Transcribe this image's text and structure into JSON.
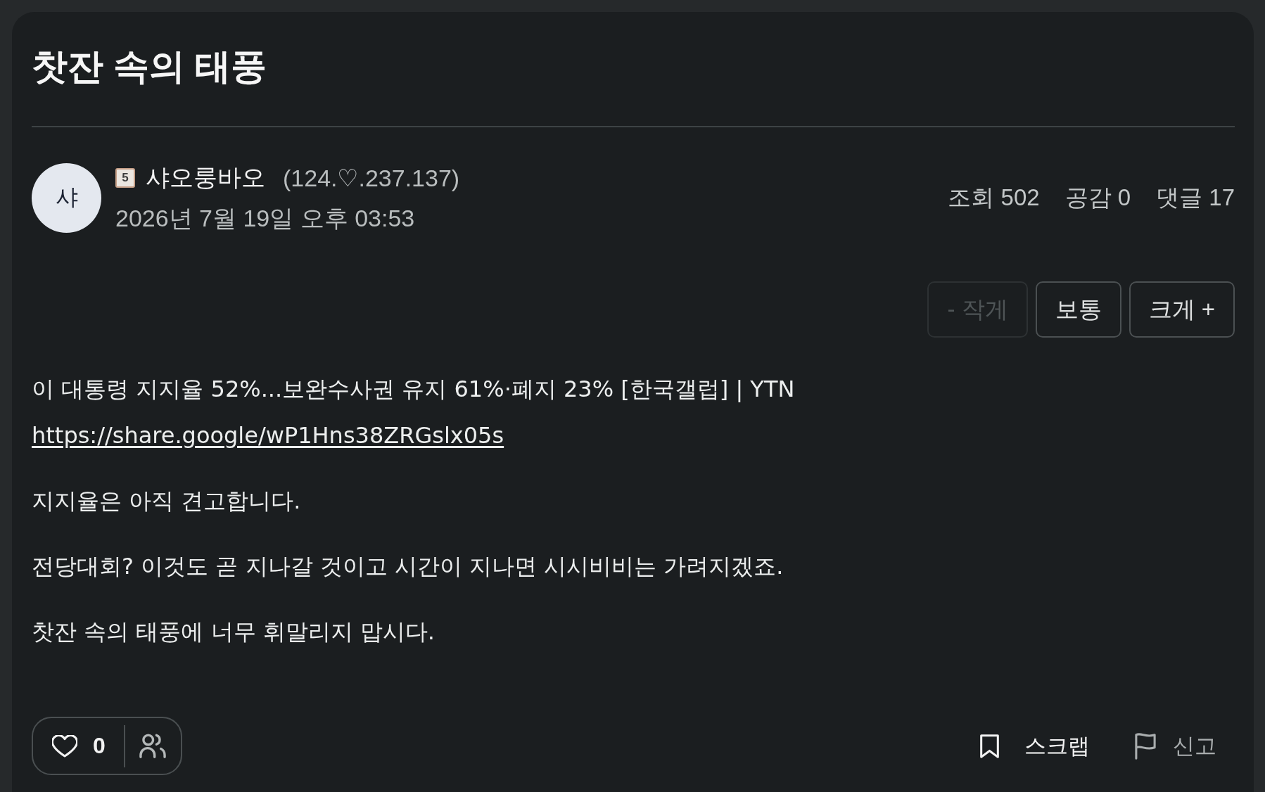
{
  "post": {
    "title": "찻잔 속의 태풍"
  },
  "author": {
    "avatar_initial": "샤",
    "level": "5",
    "name": "샤오룽바오",
    "ip": "(124.♡.237.137)",
    "date": "2026년 7월 19일 오후 03:53"
  },
  "stats": [
    "조회 502",
    "공감 0",
    "댓글 17"
  ],
  "font_size_buttons": [
    {
      "label": "- 작게",
      "disabled": true
    },
    {
      "label": "보통",
      "disabled": false
    },
    {
      "label": "크게 +",
      "disabled": false
    }
  ],
  "body": [
    {
      "text": "이 대통령 지지율 52%...보완수사권 유지 61%·폐지 23% [한국갤럽] | YTN",
      "link": "https://share.google/wP1Hns38ZRGslx05s"
    },
    {
      "text": "지지율은 아직 견고합니다."
    },
    {
      "text": "전당대회? 이것도 곧 지나갈 것이고 시간이 지나면 시시비비는 가려지겠죠."
    },
    {
      "text": "찻잔 속의 태풍에 너무 휘말리지 맙시다."
    }
  ],
  "like": {
    "count": "0"
  },
  "actions": [
    {
      "kind": "scrap",
      "label": "스크랩"
    },
    {
      "kind": "report",
      "label": "신고"
    }
  ]
}
